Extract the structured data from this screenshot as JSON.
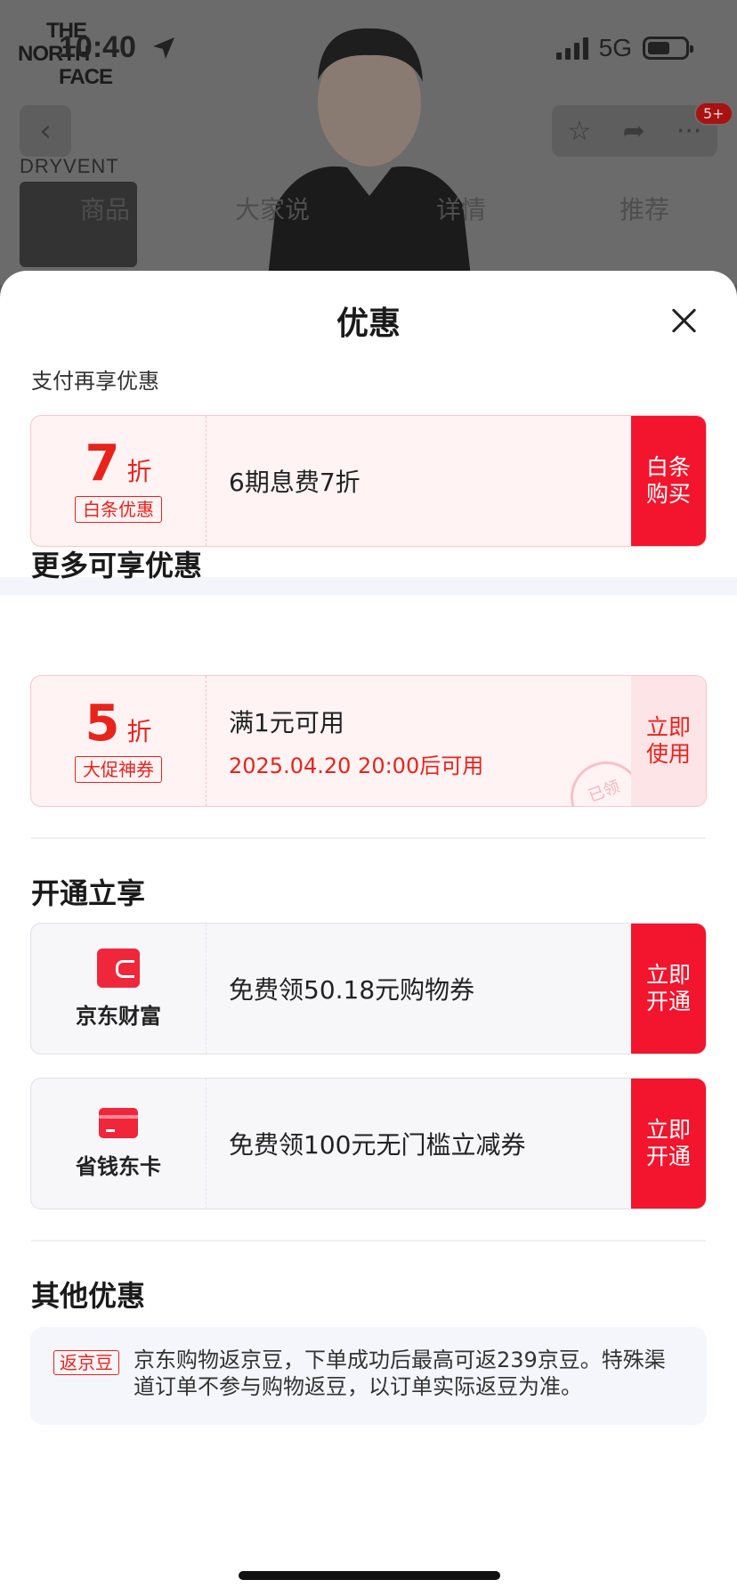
{
  "background": {
    "status_time": "10:40",
    "network": "5G",
    "brand_logo_lines": [
      "THE",
      "NORTH",
      "FACE"
    ],
    "dryvent_label": "DRYVENT",
    "notification_badge": "5+",
    "tabs": [
      "商品",
      "大家说",
      "详情",
      "推荐"
    ]
  },
  "sheet": {
    "title": "优惠",
    "pay_section_label": "支付再享优惠",
    "baitiao_card": {
      "discount_number": "7",
      "discount_unit": "折",
      "tag": "白条优惠",
      "main_text": "6期息费7折",
      "button_label": "白条购买"
    },
    "more_section_title": "更多可享优惠",
    "promo_card": {
      "discount_number": "5",
      "discount_unit": "折",
      "tag": "大促神券",
      "main_text": "满1元可用",
      "sub_text": "2025.04.20 20:00后可用",
      "button_label": "立即使用",
      "stamp_text": "已领"
    },
    "activate_section_title": "开通立享",
    "jd_finance_card": {
      "icon": "wallet-icon",
      "label": "京东财富",
      "main_text": "免费领50.18元购物券",
      "button_label": "立即开通"
    },
    "saving_card": {
      "icon": "bank-card-icon",
      "label": "省钱东卡",
      "main_text": "免费领100元无门槛立减券",
      "button_label": "立即开通"
    },
    "other_section_title": "其他优惠",
    "other_offer": {
      "tag": "返京豆",
      "text": "京东购物返京豆，下单成功后最高可返239京豆。特殊渠道订单不参与购物返豆，以订单实际返豆为准。"
    }
  },
  "colors": {
    "accent_red": "#f2152d",
    "text_red": "#e8231c",
    "pink_card_bg": "#fff3f4",
    "gray_card_bg": "#f7f7fa"
  }
}
